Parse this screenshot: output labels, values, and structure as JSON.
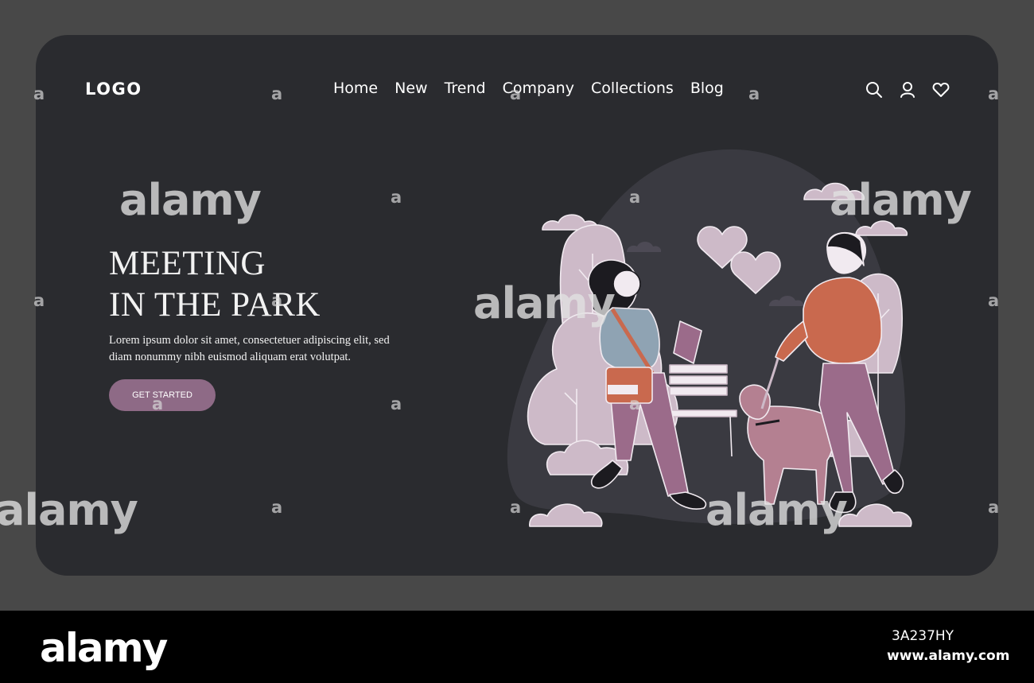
{
  "header": {
    "logo": "LOGO",
    "nav": [
      "Home",
      "New",
      "Trend",
      "Company",
      "Collections",
      "Blog"
    ],
    "icons": [
      "search-icon",
      "user-icon",
      "heart-icon"
    ]
  },
  "hero": {
    "title_line1": "MEETING",
    "title_line2": "IN THE PARK",
    "body_line1": "Lorem ipsum dolor sit amet, consectetuer adipiscing elit, sed",
    "body_line2": "diam nonummy nibh euismod aliquam erat volutpat.",
    "cta_label": "GET STARTED"
  },
  "watermark": {
    "text": "alamy",
    "mark": "a"
  },
  "footer": {
    "brand": "alamy",
    "image_id": "3A237HY",
    "url": "www.alamy.com"
  },
  "colors": {
    "page_background": "#484848",
    "card_background": "#2a2b2f",
    "cta": "#8e6a86",
    "hoodie": "#c9694e",
    "pants": "#9b6b8a",
    "tree": "#cdbac8",
    "dog": "#b48091",
    "bag": "#c9694e"
  }
}
